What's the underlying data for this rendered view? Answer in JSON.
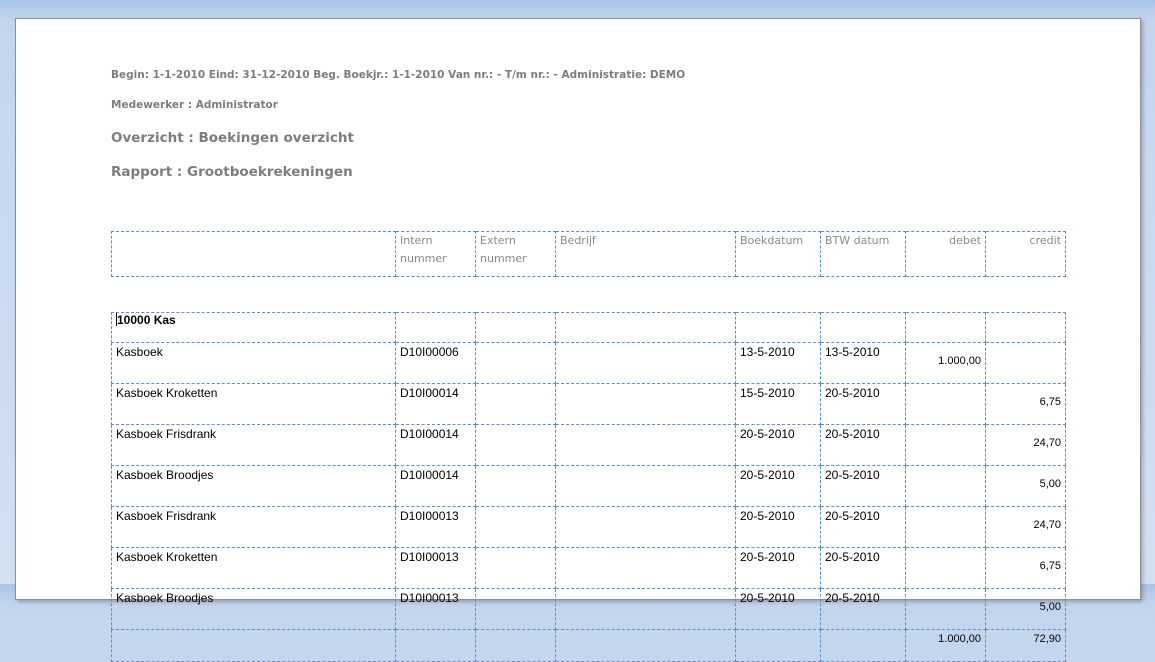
{
  "report": {
    "params_line": "Begin: 1-1-2010 Eind: 31-12-2010 Beg. Boekjr.: 1-1-2010 Van nr.: - T/m nr.: - Administratie: DEMO",
    "employee_line": "Medewerker : Administrator",
    "overview_line": "Overzicht : Boekingen overzicht",
    "report_line": "Rapport : Grootboekrekeningen"
  },
  "columns": {
    "description": "",
    "intern": "Intern nummer",
    "extern": "Extern nummer",
    "company": "Bedrijf",
    "book_date": "Boekdatum",
    "vat_date": "BTW datum",
    "debit": "debet",
    "credit": "credit"
  },
  "group": {
    "label": "10000 Kas"
  },
  "rows": [
    {
      "description": "Kasboek",
      "intern": "D10I00006",
      "extern": "",
      "company": "",
      "book_date": "13-5-2010",
      "vat_date": "13-5-2010",
      "debit": "1.000,00",
      "credit": ""
    },
    {
      "description": "Kasboek Kroketten",
      "intern": "D10I00014",
      "extern": "",
      "company": "",
      "book_date": "15-5-2010",
      "vat_date": "20-5-2010",
      "debit": "",
      "credit": "6,75"
    },
    {
      "description": "Kasboek Frisdrank",
      "intern": "D10I00014",
      "extern": "",
      "company": "",
      "book_date": "20-5-2010",
      "vat_date": "20-5-2010",
      "debit": "",
      "credit": "24,70"
    },
    {
      "description": "Kasboek Broodjes",
      "intern": "D10I00014",
      "extern": "",
      "company": "",
      "book_date": "20-5-2010",
      "vat_date": "20-5-2010",
      "debit": "",
      "credit": "5,00"
    },
    {
      "description": "Kasboek Frisdrank",
      "intern": "D10I00013",
      "extern": "",
      "company": "",
      "book_date": "20-5-2010",
      "vat_date": "20-5-2010",
      "debit": "",
      "credit": "24,70"
    },
    {
      "description": "Kasboek Kroketten",
      "intern": "D10I00013",
      "extern": "",
      "company": "",
      "book_date": "20-5-2010",
      "vat_date": "20-5-2010",
      "debit": "",
      "credit": "6,75"
    },
    {
      "description": "Kasboek Broodjes",
      "intern": "D10I00013",
      "extern": "",
      "company": "",
      "book_date": "20-5-2010",
      "vat_date": "20-5-2010",
      "debit": "",
      "credit": "5,00"
    }
  ],
  "totals": {
    "debit": "1.000,00",
    "credit": "72,90"
  }
}
